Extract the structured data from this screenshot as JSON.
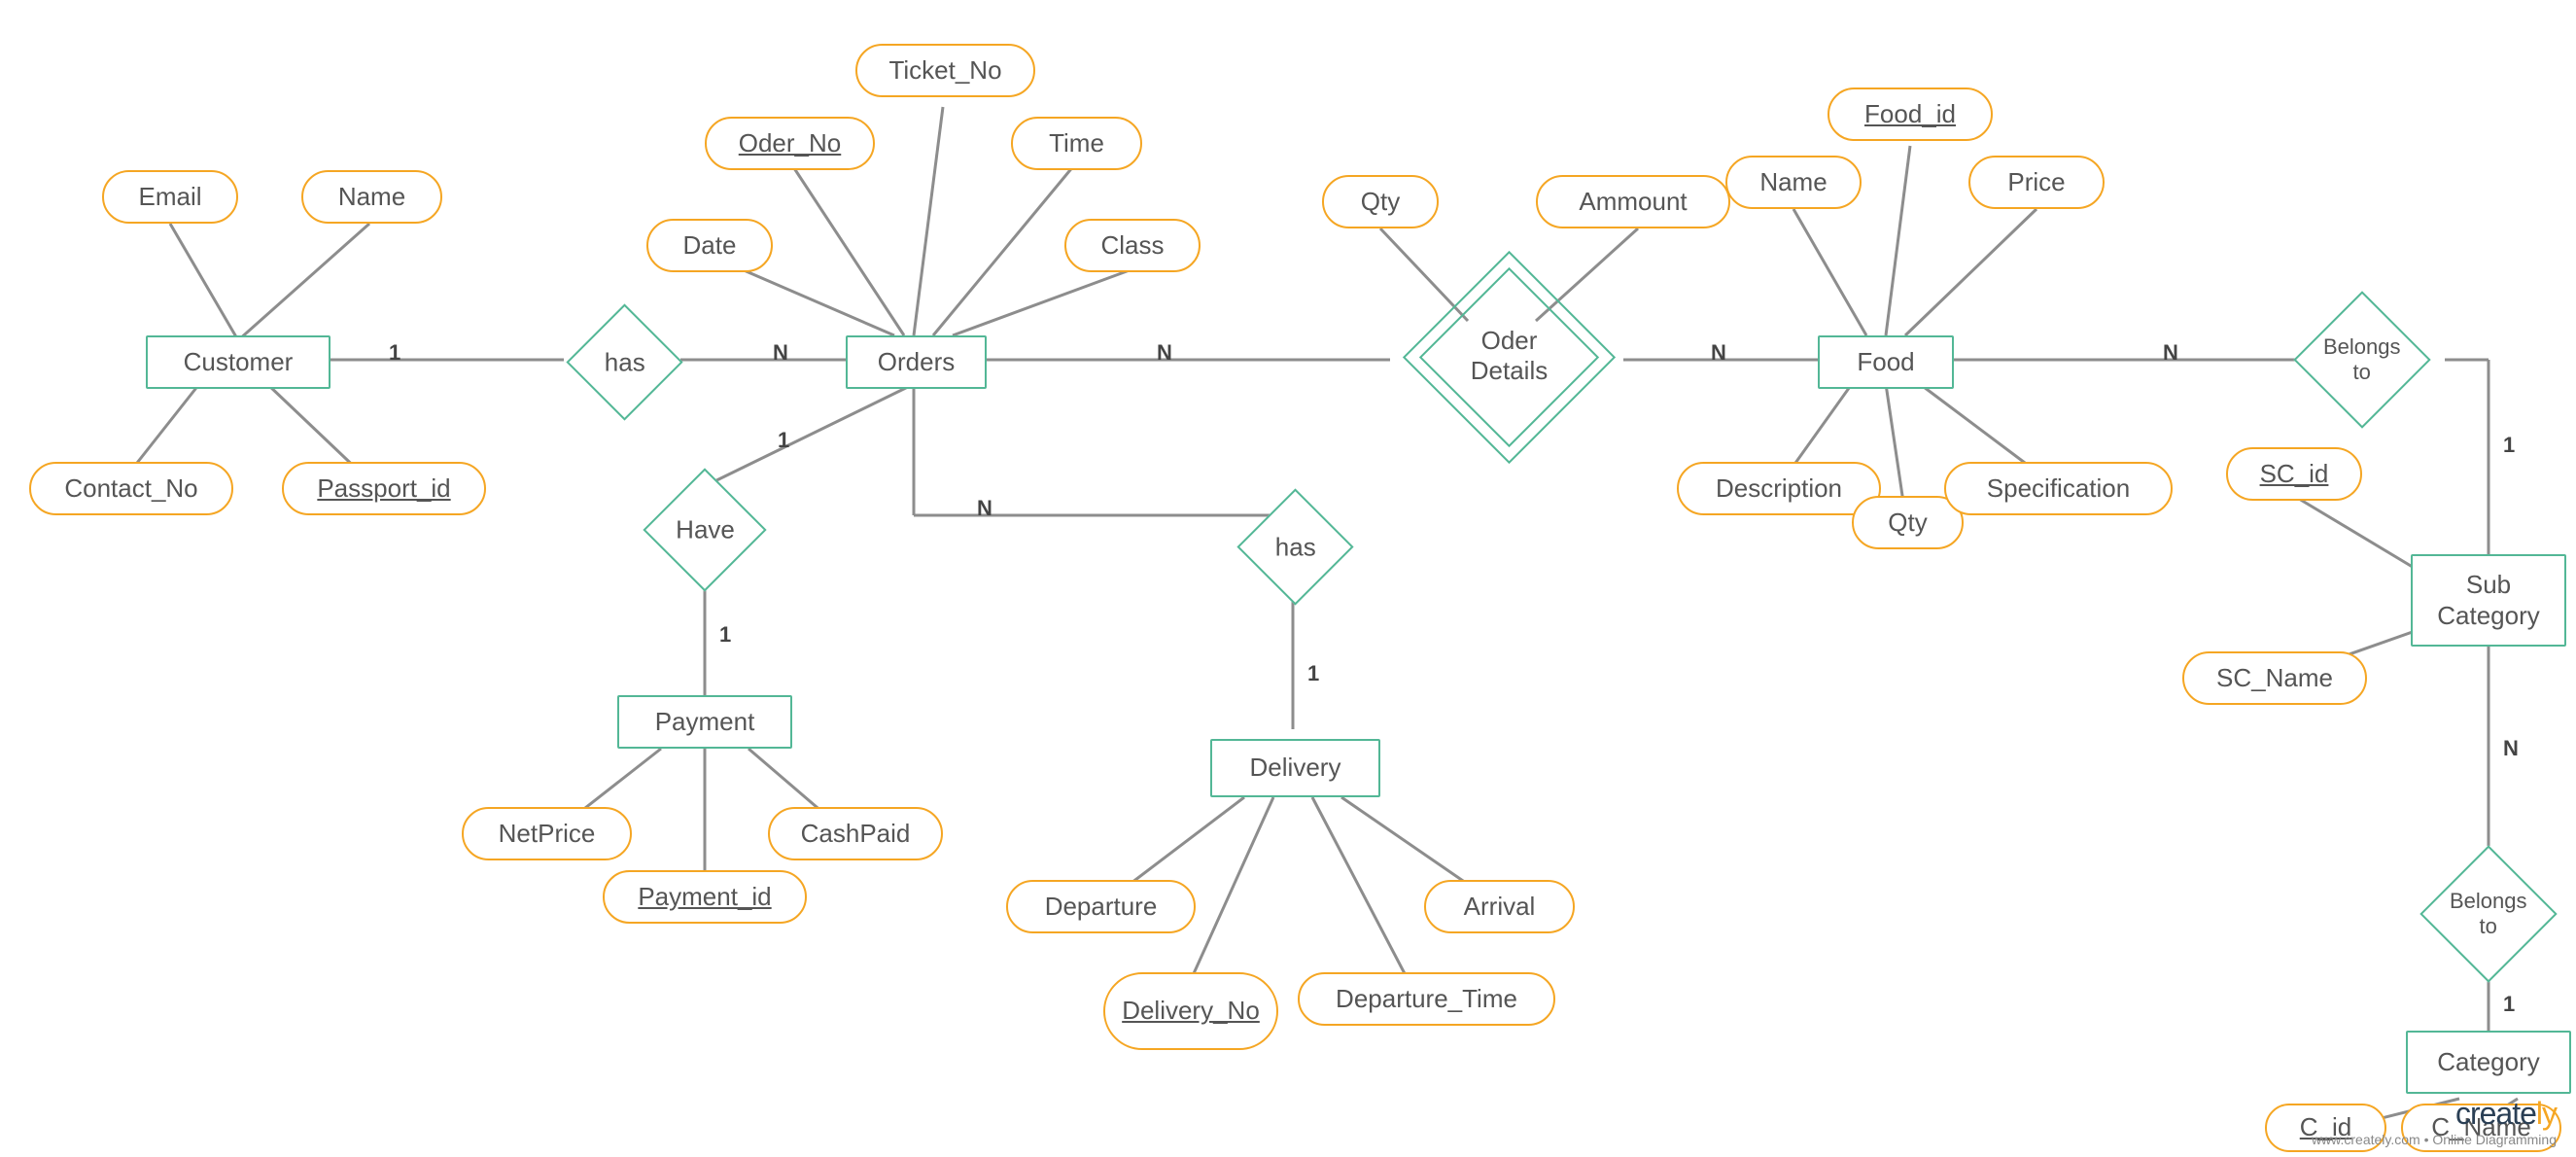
{
  "entities": {
    "customer": "Customer",
    "orders": "Orders",
    "payment": "Payment",
    "delivery": "Delivery",
    "food": "Food",
    "sub_category": "Sub Category",
    "category": "Category"
  },
  "relationships": {
    "customer_orders": "has",
    "orders_payment": "Have",
    "orders_delivery": "has",
    "orders_food_weak": "Oder Details",
    "food_subcat": "Belongs to",
    "subcat_cat": "Belongs to"
  },
  "attributes": {
    "customer": {
      "email": "Email",
      "name": "Name",
      "contact_no": "Contact_No",
      "passport_id": "Passport_id"
    },
    "orders": {
      "date": "Date",
      "oder_no": "Oder_No",
      "ticket_no": "Ticket_No",
      "time": "Time",
      "class": "Class"
    },
    "oder_details": {
      "qty": "Qty",
      "ammount": "Ammount"
    },
    "food": {
      "name": "Name",
      "food_id": "Food_id",
      "price": "Price",
      "description": "Description",
      "qty": "Qty",
      "specification": "Specification"
    },
    "payment": {
      "net_price": "NetPrice",
      "payment_id": "Payment_id",
      "cash_paid": "CashPaid"
    },
    "delivery": {
      "departure": "Departure",
      "delivery_no": "Delivery_No",
      "departure_time": "Departure_Time",
      "arrival": "Arrival"
    },
    "sub_category": {
      "sc_id": "SC_id",
      "sc_name": "SC_Name"
    },
    "category": {
      "c_id": "C_id",
      "c_name": "C_Name"
    }
  },
  "cardinalities": {
    "customer_1": "1",
    "orders_N_fromcust": "N",
    "orders_1_topayment": "1",
    "payment_1": "1",
    "orders_N_todelivery": "N",
    "delivery_1": "1",
    "orders_N_toweak": "N",
    "food_N_toweak": "N",
    "food_N_tosub": "N",
    "sub_1_fromfood": "1",
    "sub_N_tocat": "N",
    "cat_1": "1"
  },
  "watermark": {
    "brand_pre": "create",
    "brand_post": "ly",
    "tagline": "www.creately.com • Online Diagramming"
  }
}
